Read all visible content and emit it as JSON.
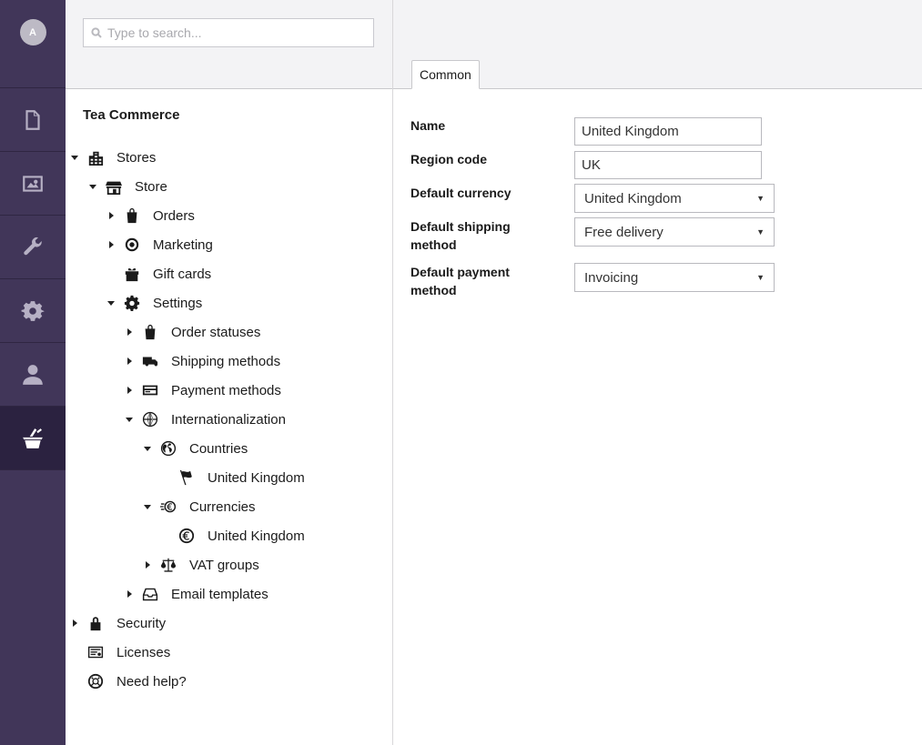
{
  "user": {
    "initial": "A"
  },
  "app_nav": [
    {
      "name": "content",
      "icon": "document-icon"
    },
    {
      "name": "media",
      "icon": "image-icon"
    },
    {
      "name": "developer",
      "icon": "wrench-icon"
    },
    {
      "name": "settings",
      "icon": "gear-icon"
    },
    {
      "name": "members",
      "icon": "user-icon"
    },
    {
      "name": "tea-commerce",
      "icon": "basket-icon",
      "active": true
    }
  ],
  "search": {
    "placeholder": "Type to search..."
  },
  "tree": {
    "title": "Tea Commerce",
    "items": [
      {
        "label": "Stores",
        "level": 0,
        "caret": "down",
        "icon": "buildings-icon"
      },
      {
        "label": "Store",
        "level": 1,
        "caret": "down",
        "icon": "shop-icon"
      },
      {
        "label": "Orders",
        "level": 2,
        "caret": "right",
        "icon": "bag-icon"
      },
      {
        "label": "Marketing",
        "level": 2,
        "caret": "right",
        "icon": "target-icon"
      },
      {
        "label": "Gift cards",
        "level": 2,
        "caret": "none",
        "icon": "gift-icon"
      },
      {
        "label": "Settings",
        "level": 2,
        "caret": "down",
        "icon": "gear-icon"
      },
      {
        "label": "Order statuses",
        "level": 3,
        "caret": "right",
        "icon": "bag-icon"
      },
      {
        "label": "Shipping methods",
        "level": 3,
        "caret": "right",
        "icon": "truck-icon"
      },
      {
        "label": "Payment methods",
        "level": 3,
        "caret": "right",
        "icon": "credit-card-icon"
      },
      {
        "label": "Internationalization",
        "level": 3,
        "caret": "down",
        "icon": "globe-icon"
      },
      {
        "label": "Countries",
        "level": 4,
        "caret": "down",
        "icon": "earth-icon"
      },
      {
        "label": "United Kingdom",
        "level": 5,
        "caret": "none",
        "icon": "flag-icon"
      },
      {
        "label": "Currencies",
        "level": 4,
        "caret": "down",
        "icon": "coins-icon"
      },
      {
        "label": "United Kingdom",
        "level": 5,
        "caret": "none",
        "icon": "coin-icon"
      },
      {
        "label": "VAT groups",
        "level": 4,
        "caret": "right",
        "icon": "scales-icon"
      },
      {
        "label": "Email templates",
        "level": 3,
        "caret": "right",
        "icon": "inbox-icon"
      },
      {
        "label": "Security",
        "level": 0,
        "caret": "right",
        "icon": "lock-icon"
      },
      {
        "label": "Licenses",
        "level": 0,
        "caret": "none",
        "icon": "license-icon"
      },
      {
        "label": "Need help?",
        "level": 0,
        "caret": "none",
        "icon": "lifebuoy-icon"
      }
    ]
  },
  "editor": {
    "tab": "Common",
    "fields": {
      "name": {
        "label": "Name",
        "value": "United Kingdom"
      },
      "region_code": {
        "label": "Region code",
        "value": "UK"
      },
      "default_currency": {
        "label": "Default currency",
        "value": "United Kingdom"
      },
      "default_shipping": {
        "label_line1": "Default shipping",
        "label_line2": "method",
        "value": "Free delivery"
      },
      "default_payment": {
        "label_line1": "Default payment",
        "label_line2": "method",
        "value": "Invoicing"
      }
    }
  },
  "colors": {
    "sidebar": "#413659",
    "sidebar_active": "#2b2240",
    "header_bg": "#f3f3f5"
  }
}
